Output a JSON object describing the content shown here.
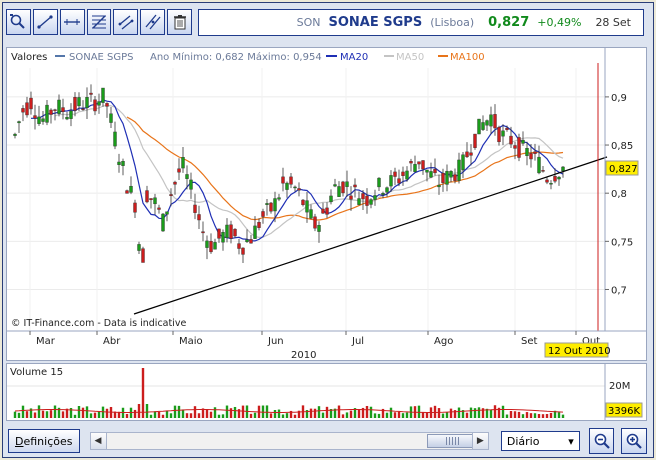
{
  "toolbar": {
    "buttons": [
      {
        "id": "zoom-area",
        "icon": "magnifier-icon"
      },
      {
        "id": "line",
        "icon": "trend-line-icon"
      },
      {
        "id": "horizontal-line",
        "icon": "horizontal-line-icon"
      },
      {
        "id": "fibonacci",
        "icon": "fibonacci-icon"
      },
      {
        "id": "channel",
        "icon": "channel-icon"
      },
      {
        "id": "parallel-lines",
        "icon": "parallel-lines-icon"
      },
      {
        "id": "delete",
        "icon": "trash-icon"
      }
    ]
  },
  "quote": {
    "ticker": "SON",
    "name": "SONAE SGPS",
    "exchange": "(Lisboa)",
    "price": "0,827",
    "change": "+0,49%",
    "date": "28 Set"
  },
  "legend": {
    "prefix": "Valores",
    "series_name": "SONAE SGPS",
    "stats": "Ano Mínimo: 0,682 Máximo: 0,954",
    "ma20": "MA20",
    "ma50": "MA50",
    "ma100": "MA100"
  },
  "colors": {
    "up": "#1a9c1a",
    "down": "#cc1d1d",
    "ma20": "#1f2fb5",
    "ma50": "#c4c4c4",
    "ma100": "#e8741a",
    "trendline": "#000000",
    "price_tag": "#ffee00"
  },
  "price_axis": {
    "ticks": [
      "0,9",
      "0,85",
      "0,8",
      "0,75",
      "0,7"
    ],
    "current_label": "0,827"
  },
  "months": [
    "Mar",
    "Abr",
    "Maio",
    "Jun",
    "Jul",
    "Ago",
    "Set",
    "Out"
  ],
  "year_label": "2010",
  "date_marker": "12 Out 2010",
  "watermark": "© IT-Finance.com - Data is indicative",
  "volume": {
    "title": "Volume 15",
    "axis_label": "20M",
    "last_label": "3396K"
  },
  "bottom": {
    "settings_prefix": "D",
    "settings_rest": "efinições",
    "period": "Diário"
  },
  "chart_data": {
    "type": "candlestick",
    "title": "SONAE SGPS",
    "x_range": [
      "Mar 2010",
      "Out 2010"
    ],
    "ylim": [
      0.66,
      0.93
    ],
    "year_min": 0.682,
    "year_max": 0.954,
    "last_close": 0.827,
    "series": [
      {
        "name": "SONAE SGPS",
        "kind": "candles"
      },
      {
        "name": "MA20",
        "kind": "line"
      },
      {
        "name": "MA50",
        "kind": "line"
      },
      {
        "name": "MA100",
        "kind": "line"
      }
    ],
    "volume_axis": [
      "20M"
    ],
    "last_volume": "3396K"
  }
}
